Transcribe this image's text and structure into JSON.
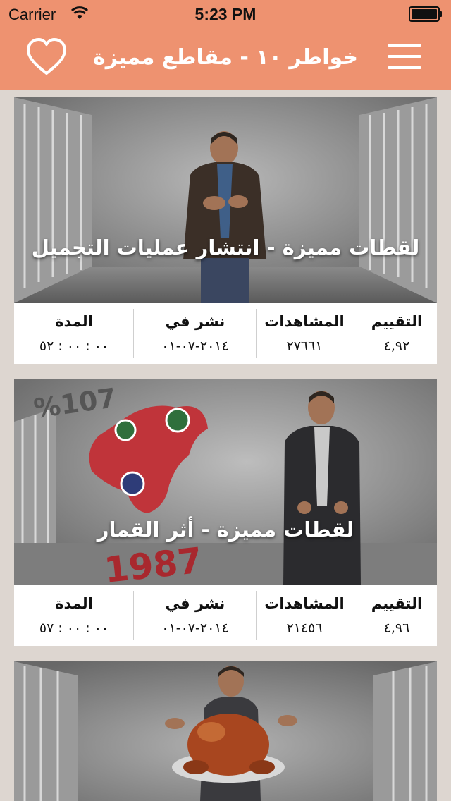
{
  "status_bar": {
    "carrier": "Carrier",
    "time": "5:23 PM"
  },
  "nav": {
    "title": "خواطر ١٠ - مقاطع مميزة"
  },
  "labels": {
    "rating": "التقييم",
    "views": "المشاهدات",
    "published": "نشر في",
    "duration": "المدة"
  },
  "colors": {
    "nav_bg": "#ee9270",
    "page_bg": "#ddd6d0"
  },
  "videos": [
    {
      "title": "لقطات مميزة - انتشار عمليات التجميل",
      "rating": "٤,٩٢",
      "views": "٢٧٦٦١",
      "published": "٢٠١٤-٠٧-٠١",
      "duration": "٠٠ : ٠٠ : ٥٢"
    },
    {
      "title": "لقطات مميزة - أثر القمار",
      "rating": "٤,٩٦",
      "views": "٢١٤٥٦",
      "published": "٢٠١٤-٠٧-٠١",
      "duration": "٠٠ : ٠٠ : ٥٧",
      "overlay_numbers": [
        "%107",
        "1987"
      ]
    },
    {
      "title": ""
    }
  ]
}
